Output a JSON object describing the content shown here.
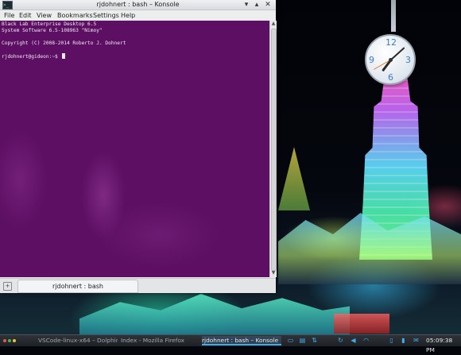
{
  "window": {
    "title": "rjdohnert : bash – Konsole",
    "controls": {
      "minimize": "▾",
      "maximize": "▴",
      "close": "✕"
    }
  },
  "menu": [
    "File",
    "Edit",
    "View",
    "Bookmarks",
    "Settings",
    "Help"
  ],
  "terminal": {
    "lines": [
      "Black Lab Enterprise Desktop 6.5",
      "System Software 6.5-108963 \"Nimoy\"",
      "",
      "Copyright (C) 2008-2014 Roberto J. Dohnert",
      "",
      "rjdohnert@gideon:~$ "
    ],
    "background": "#5c0f63"
  },
  "tabbar": {
    "tab_label": "rjdohnert : bash"
  },
  "clock_widget": {
    "numerals": [
      "12",
      "3",
      "6",
      "9"
    ],
    "accent": "#3b7fc4"
  },
  "taskbar": {
    "launcher_colors": [
      "#e05a5a",
      "#4caf50",
      "#f0c040"
    ],
    "tasks": [
      {
        "label": "VSCode-linux-x64 – Dolphin",
        "active": false
      },
      {
        "label": "Index - Mozilla Firefox",
        "active": false
      },
      {
        "label": "rjdohnert : bash – Konsole",
        "active": true
      }
    ],
    "tray_icons": [
      "monitor-icon",
      "paste-icon",
      "network-icon",
      "refresh-icon",
      "volume-icon",
      "wifi-icon",
      "device-icon",
      "battery-icon",
      "mail-icon"
    ],
    "time": "05:09:38 PM",
    "accent": "#3daee9"
  }
}
